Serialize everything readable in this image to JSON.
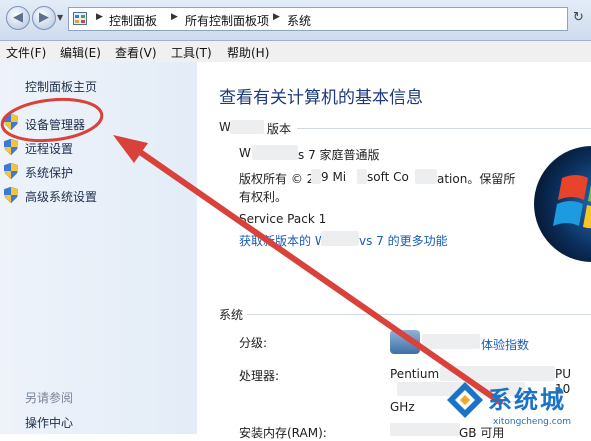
{
  "breadcrumb": [
    "控制面板",
    "所有控制面板项",
    "系统"
  ],
  "menu": [
    "文件(F)",
    "编辑(E)",
    "查看(V)",
    "工具(T)",
    "帮助(H)"
  ],
  "left_pane": {
    "home": "控制面板主页",
    "links": [
      "设备管理器",
      "远程设置",
      "系统保护",
      "高级系统设置"
    ],
    "see_also_label": "另请参阅",
    "see_also_links": [
      "操作中心"
    ]
  },
  "main": {
    "title": "查看有关计算机的基本信息",
    "edition_heading_pre": "W",
    "edition_heading_post": "版本",
    "edition_name": "s 7 家庭普通版",
    "edition_name_pre": "W",
    "copyright_line1_a": "版权所有 © 2",
    "copyright_line1_b": "9 Mi",
    "copyright_line1_c": "soft Co",
    "copyright_line1_d": "ation。保留所",
    "copyright_line2": "有权利。",
    "service_pack": "Service Pack 1",
    "upgrade_link_a": "获取新版本的 W",
    "upgrade_link_b": "vs 7 的更多功能",
    "system_heading": "系统",
    "rating_label": "分级:",
    "rating_link": "体验指数",
    "processor_label": "处理器:",
    "processor_value_a": "Pentium",
    "processor_value_b": "PU",
    "processor_value_c": "10",
    "processor_unit": "GHz",
    "ram_label": "安装内存(RAM):",
    "ram_value": "GB 可用"
  },
  "watermark": {
    "text": "系统城",
    "url": "xitongcheng.com"
  },
  "colors": {
    "annotation": "#d9423a",
    "link": "#1a5bb5",
    "title": "#1d3a7d"
  }
}
